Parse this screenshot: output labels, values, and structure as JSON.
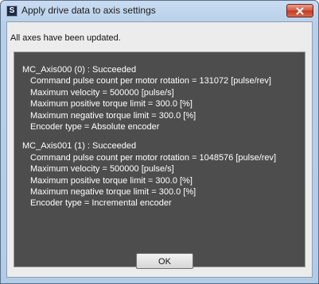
{
  "window": {
    "title": "Apply drive data to axis settings",
    "icon_glyph": "S"
  },
  "status": "All axes have been updated.",
  "axes": [
    {
      "header": "MC_Axis000 (0) : Succeeded",
      "details": [
        "Command pulse count per motor rotation = 131072 [pulse/rev]",
        "Maximum velocity = 500000 [pulse/s]",
        "Maximum positive torque limit = 300.0 [%]",
        "Maximum negative torque limit = 300.0 [%]",
        "Encoder type = Absolute encoder"
      ]
    },
    {
      "header": "MC_Axis001 (1) : Succeeded",
      "details": [
        "Command pulse count per motor rotation = 1048576 [pulse/rev]",
        "Maximum velocity = 500000 [pulse/s]",
        "Maximum positive torque limit = 300.0 [%]",
        "Maximum negative torque limit = 300.0 [%]",
        "Encoder type = Incremental encoder"
      ]
    }
  ],
  "buttons": {
    "ok_label": "OK"
  },
  "icons": {
    "close": "close-icon",
    "app": "app-icon"
  },
  "colors": {
    "results_background": "#4d4d4d",
    "results_text": "#ffffff",
    "close_button": "#c94a30"
  }
}
